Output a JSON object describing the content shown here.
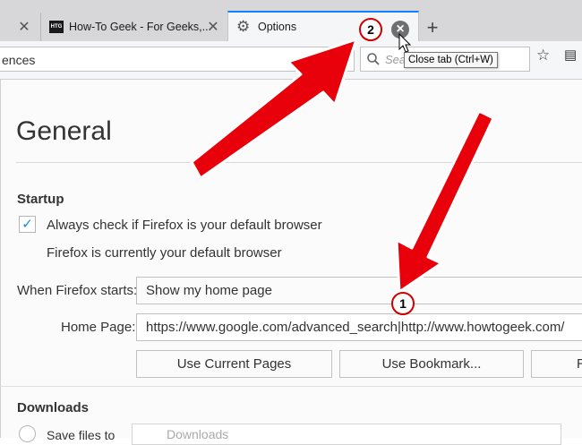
{
  "tabs": [
    {
      "title": ""
    },
    {
      "title": "How-To Geek - For Geeks,...",
      "favicon_text": "HTG"
    },
    {
      "title": "Options"
    }
  ],
  "navbar": {
    "url_fragment": "ences",
    "search_placeholder": "Sea",
    "tooltip": "Close tab (Ctrl+W)"
  },
  "page": {
    "title": "General",
    "startup": {
      "heading": "Startup",
      "checkbox_label": "Always check if Firefox is your default browser",
      "default_status": "Firefox is currently your default browser",
      "when_starts_label": "When Firefox starts:",
      "when_starts_value": "Show my home page",
      "home_page_label": "Home Page:",
      "home_page_value": "https://www.google.com/advanced_search|http://www.howtogeek.com/",
      "btn_current": "Use Current Pages",
      "btn_bookmark": "Use Bookmark...",
      "btn_restore": "R"
    },
    "downloads": {
      "heading": "Downloads",
      "save_label": "Save files to",
      "folder": "Downloads"
    }
  },
  "annotations": {
    "badge_1": "1",
    "badge_2": "2",
    "arrow_color": "#e8000b"
  }
}
